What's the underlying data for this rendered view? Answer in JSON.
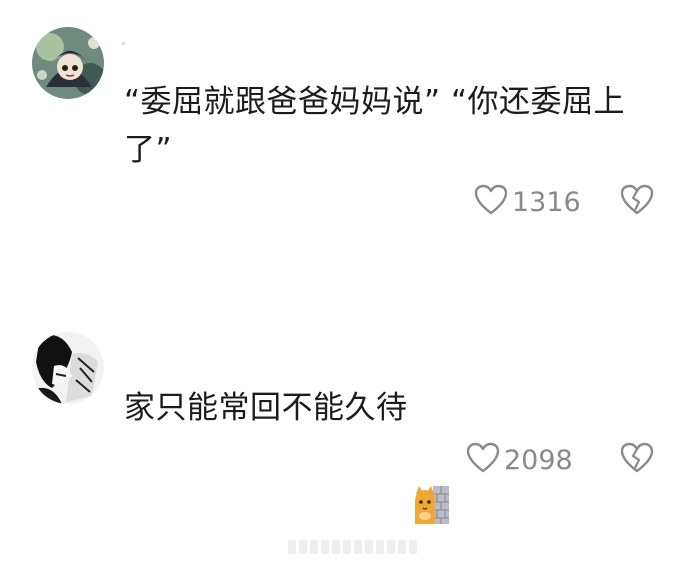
{
  "comments": [
    {
      "text": "“委屈就跟爸爸妈妈说” “你还委屈上了”",
      "likes": "1316"
    },
    {
      "text": "家只能常回不能久待",
      "emoji": "cat-behind-wall-emoji",
      "likes": "2098"
    }
  ],
  "icons": {
    "like": "heart-outline-icon",
    "dislike": "broken-heart-icon"
  },
  "colors": {
    "text": "#1c1c1c",
    "meta": "#8a8a8a",
    "background": "#ffffff"
  }
}
